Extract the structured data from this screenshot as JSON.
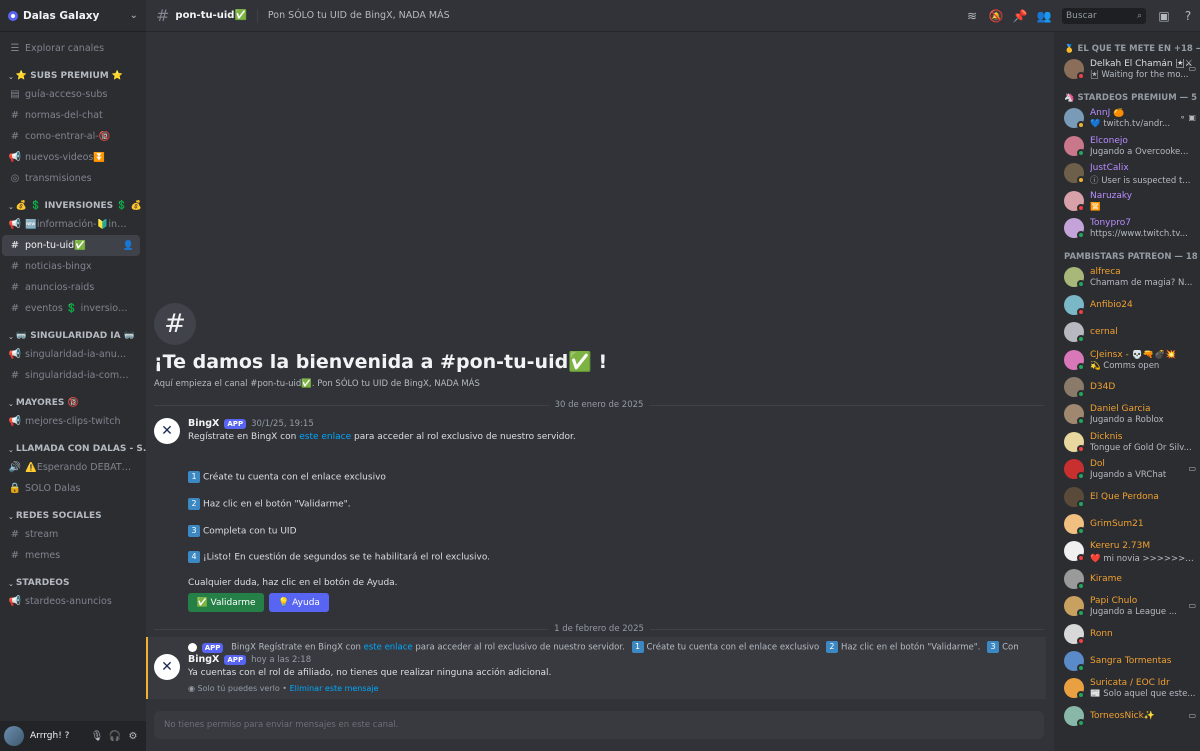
{
  "server": {
    "name": "Dalas Galaxy"
  },
  "sidebar": {
    "explore": "Explorar canales",
    "sections": [
      {
        "category": "⭐ SUBS PREMIUM ⭐",
        "channels": [
          {
            "icon": "rules-icon",
            "glyph": "▤",
            "label": "guía-acceso-subs"
          },
          {
            "icon": "hash-icon",
            "glyph": "#",
            "label": "normas-del-chat"
          },
          {
            "icon": "hash-icon",
            "glyph": "#",
            "label": "como-entrar-al-🔞"
          },
          {
            "icon": "announcement-icon",
            "glyph": "📢",
            "label": "nuevos-videos⏬"
          },
          {
            "icon": "stage-icon",
            "glyph": "◎",
            "label": "transmisiones"
          }
        ]
      },
      {
        "category": "💰 💲 INVERSIONES 💲 💰",
        "channels": [
          {
            "icon": "announcement-icon",
            "glyph": "📢",
            "label": "🆕información-🔰inver..."
          },
          {
            "icon": "hash-icon",
            "glyph": "#",
            "label": "pon-tu-uid✅",
            "active": true
          },
          {
            "icon": "hash-icon",
            "glyph": "#",
            "label": "noticias-bingx"
          },
          {
            "icon": "hash-icon",
            "glyph": "#",
            "label": "anuncios-raids"
          },
          {
            "icon": "hash-icon",
            "glyph": "#",
            "label": "eventos 💲 inversiones"
          }
        ]
      },
      {
        "category": "🥽 SINGULARIDAD IA 🥽",
        "channels": [
          {
            "icon": "announcement-icon",
            "glyph": "📢",
            "label": "singularidad-ia-anuncios"
          },
          {
            "icon": "hash-icon",
            "glyph": "#",
            "label": "singularidad-ia-comunid..."
          }
        ]
      },
      {
        "category": "MAYORES 🔞",
        "channels": [
          {
            "icon": "announcement-icon",
            "glyph": "📢",
            "label": "mejores-clips-twitch"
          }
        ]
      },
      {
        "category": "LLAMADA CON DALAS - S...",
        "channels": [
          {
            "icon": "voice-icon",
            "glyph": "🔊",
            "label": "⚠️Esperando DEBATE⚠️"
          },
          {
            "icon": "lock-icon",
            "glyph": "🔒",
            "label": "SÓLO Dalas"
          }
        ]
      },
      {
        "category": "REDES SOCIALES",
        "channels": [
          {
            "icon": "hash-icon",
            "glyph": "#",
            "label": "stream"
          },
          {
            "icon": "hash-icon",
            "glyph": "#",
            "label": "memes"
          }
        ]
      },
      {
        "category": "STARDEOS",
        "channels": [
          {
            "icon": "announcement-icon",
            "glyph": "📢",
            "label": "stardeos-anuncios"
          }
        ]
      }
    ]
  },
  "user": {
    "name": "Arrrgh! ?"
  },
  "topbar": {
    "channel": "pon-tu-uid✅",
    "topic": "Pon SÓLO tu UID de BingX, NADA MÁS",
    "search_placeholder": "Buscar"
  },
  "main": {
    "welcome_title": "¡Te damos la bienvenida a #pon-tu-uid✅ !",
    "welcome_sub": "Aquí empieza el canal #pon-tu-uid✅. Pon SÓLO tu UID de BingX, NADA MÁS",
    "date1": "30 de enero de 2025",
    "date2": "1 de febrero de 2025",
    "msg1": {
      "author": "BingX",
      "badge": "APP",
      "time": "30/1/25, 19:15",
      "line1_pre": "Regístrate en BingX con",
      "line1_link": "este enlace",
      "line1_post": "para acceder al rol exclusivo de nuestro servidor.",
      "steps": [
        {
          "n": "1",
          "text": "Créate tu cuenta con el enlace exclusivo"
        },
        {
          "n": "2",
          "text": "Haz clic en el botón \"Validarme\"."
        },
        {
          "n": "3",
          "text": "Completa con tu UID"
        },
        {
          "n": "4",
          "text": "¡Listo! En cuestión de segundos se te habilitará el rol exclusivo."
        }
      ],
      "footer": "Cualquier duda, haz clic en el botón de Ayuda.",
      "btn_validate": "✅ Validarme",
      "btn_help": "💡 Ayuda"
    },
    "msg2": {
      "reply_badge": "APP",
      "reply_author": "BingX",
      "reply_pre": "Regístrate en BingX con",
      "reply_link": "este enlace",
      "reply_post": "para acceder al rol exclusivo de nuestro servidor.",
      "reply_s1": "Créate tu cuenta con el enlace exclusivo",
      "reply_s2": "Haz clic en el botón \"Validarme\".",
      "reply_s3": "Completa c...",
      "author": "BingX",
      "badge": "APP",
      "time": "hoy a las 2:18",
      "text": "Ya cuentas con el rol de afiliado, no tienes que realizar ninguna acción adicional.",
      "eph_pre": "Solo tú puedes verlo •",
      "eph_link": "Eliminar este mensaje"
    },
    "composer_placeholder": "No tienes permiso para enviar mensajes en este canal."
  },
  "members": {
    "groups": [
      {
        "title": "🥇 EL QUE TE METE EN +18 — 1",
        "members": [
          {
            "name": "Delkah El Chamán 🃏⚔",
            "status": "🃏 Waiting for the mo...",
            "color": "#dbdee1",
            "dot": "#f23f43",
            "av": "#8a6e5a",
            "extra": "▭"
          }
        ]
      },
      {
        "title": "🦄 STARDEOS PREMIUM — 5",
        "members": [
          {
            "name": "AnnJ 🍊",
            "status": "💙 twitch.tv/andr...",
            "color": "#b98cff",
            "dot": "#f0b232",
            "av": "#7a9bb8",
            "extra": "⚬ ▣"
          },
          {
            "name": "Elconejo",
            "status": "Jugando a Overcooke...",
            "color": "#b98cff",
            "dot": "#23a55a",
            "av": "#c9778a",
            "extra": ""
          },
          {
            "name": "JustCalix",
            "status": "ⓘ User is suspected t...",
            "color": "#b98cff",
            "dot": "#f0b232",
            "av": "#6e5f4a",
            "extra": ""
          },
          {
            "name": "Naruzaky",
            "status": "🈺",
            "color": "#b98cff",
            "dot": "#f23f43",
            "av": "#d8a0a8",
            "extra": ""
          },
          {
            "name": "Tonypro7",
            "status": "https://www.twitch.tv...",
            "color": "#b98cff",
            "dot": "#23a55a",
            "av": "#c4a4d8",
            "extra": ""
          }
        ]
      },
      {
        "title": "PAMBISTARS PATREON — 18",
        "members": [
          {
            "name": "alfreca",
            "status": "Chamam de magia? N...",
            "color": "#f0a030",
            "dot": "#23a55a",
            "av": "#a8b878",
            "extra": ""
          },
          {
            "name": "Anfibio24",
            "status": "",
            "color": "#f0a030",
            "dot": "#f23f43",
            "av": "#7ab8c8",
            "extra": ""
          },
          {
            "name": "cernal",
            "status": "",
            "color": "#f0a030",
            "dot": "#23a55a",
            "av": "#b8b8c0",
            "extra": ""
          },
          {
            "name": "CJeinsx - 💀🔫💣💥",
            "status": "💫 Comms open",
            "color": "#f0a030",
            "dot": "#23a55a",
            "av": "#d878b8",
            "extra": ""
          },
          {
            "name": "D34D",
            "status": "",
            "color": "#f0a030",
            "dot": "#23a55a",
            "av": "#8a7a6a",
            "extra": ""
          },
          {
            "name": "Daniel Garcia",
            "status": "Jugando a Roblox",
            "color": "#f0a030",
            "dot": "#23a55a",
            "av": "#a08870",
            "extra": ""
          },
          {
            "name": "Dicknis",
            "status": "Tongue of Gold Or Silv...",
            "color": "#f0a030",
            "dot": "#f23f43",
            "av": "#e8d8a0",
            "extra": ""
          },
          {
            "name": "Dol",
            "status": "Jugando a VRChat",
            "color": "#f0a030",
            "dot": "#23a55a",
            "av": "#c83030",
            "extra": "▭"
          },
          {
            "name": "El Que Perdona",
            "status": "",
            "color": "#f0a030",
            "dot": "#23a55a",
            "av": "#5a4a3a",
            "extra": ""
          },
          {
            "name": "GrimSum21",
            "status": "",
            "color": "#f0a030",
            "dot": "#23a55a",
            "av": "#f0c080",
            "extra": ""
          },
          {
            "name": "Kereru 2.73M",
            "status": "❤️ mi novia >>>>>> 🅿",
            "color": "#f0a030",
            "dot": "#f23f43",
            "av": "#f0f0f0",
            "extra": ""
          },
          {
            "name": "Kirame",
            "status": "",
            "color": "#f0a030",
            "dot": "#23a55a",
            "av": "#9a9a9a",
            "extra": ""
          },
          {
            "name": "Papi Chulo",
            "status": "Jugando a League ...",
            "color": "#f0a030",
            "dot": "#23a55a",
            "av": "#c8a060",
            "extra": "▭"
          },
          {
            "name": "Ronn",
            "status": "",
            "color": "#f0a030",
            "dot": "#f23f43",
            "av": "#d8d8d8",
            "extra": ""
          },
          {
            "name": "Sangra Tormentas",
            "status": "",
            "color": "#f0a030",
            "dot": "#23a55a",
            "av": "#5a8ac8",
            "extra": ""
          },
          {
            "name": "Suricata / EOC ldr",
            "status": "📰 Solo aquel que este...",
            "color": "#f0a030",
            "dot": "#23a55a",
            "av": "#e8a040",
            "extra": ""
          },
          {
            "name": "TorneosNick✨",
            "status": "",
            "color": "#f0a030",
            "dot": "#23a55a",
            "av": "#8ab8a8",
            "extra": "▭"
          }
        ]
      }
    ]
  }
}
